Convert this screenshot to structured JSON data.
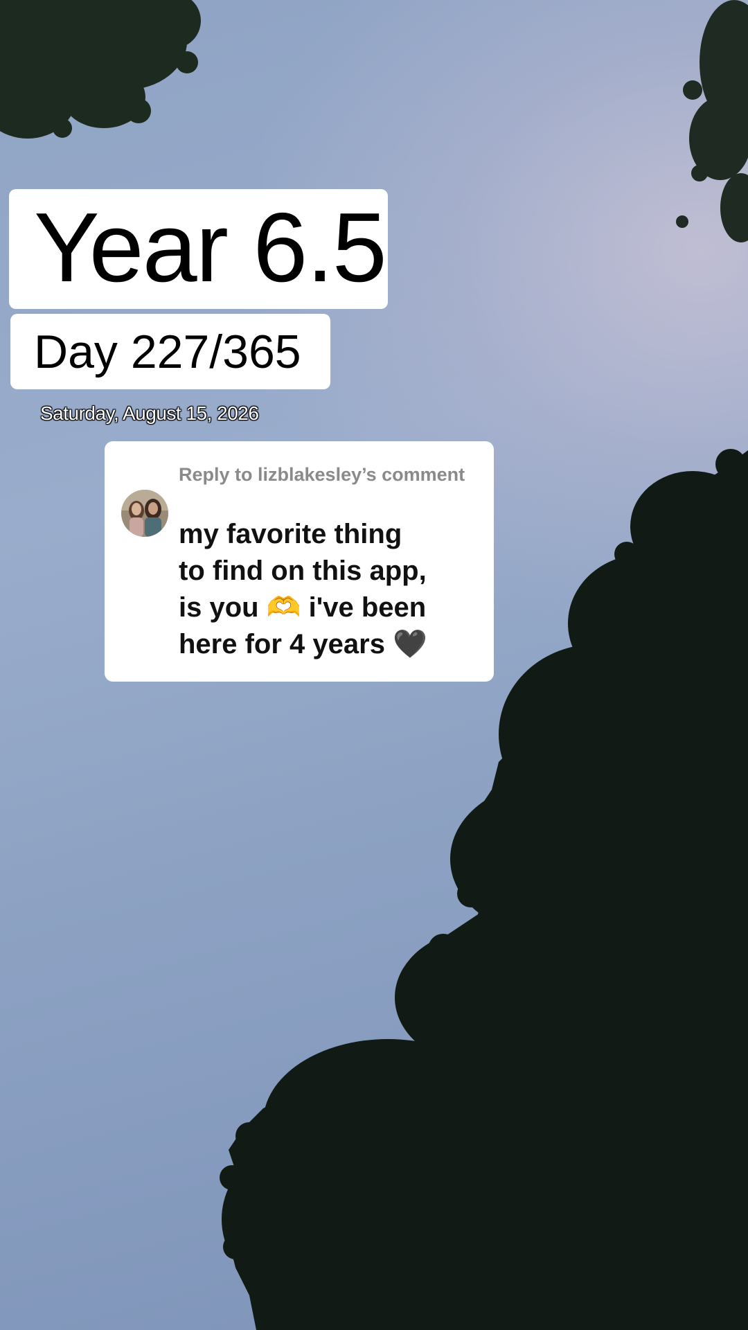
{
  "overlay": {
    "title": "Year 6.5",
    "day_counter": "Day 227/365",
    "date": "Saturday, August 15, 2026"
  },
  "comment_reply": {
    "reply_label": "Reply to lizblakesley’s comment",
    "comment_line_1": "my favorite thing",
    "comment_line_2": "to find on this app,",
    "comment_line_3a": "is you ",
    "comment_emoji_1": "🫶",
    "comment_line_3b": " i've been",
    "comment_line_4a": "here for 4 years ",
    "comment_emoji_2": "🖤"
  },
  "icons": {
    "avatar": "commenter-avatar",
    "emoji_1": "heart-hands-icon",
    "emoji_2": "black-heart-icon"
  },
  "colors": {
    "sky": "#8fa3c4",
    "trees": "#121a15",
    "overlay_bg": "#ffffff",
    "reply_label": "#8a8a8a"
  }
}
